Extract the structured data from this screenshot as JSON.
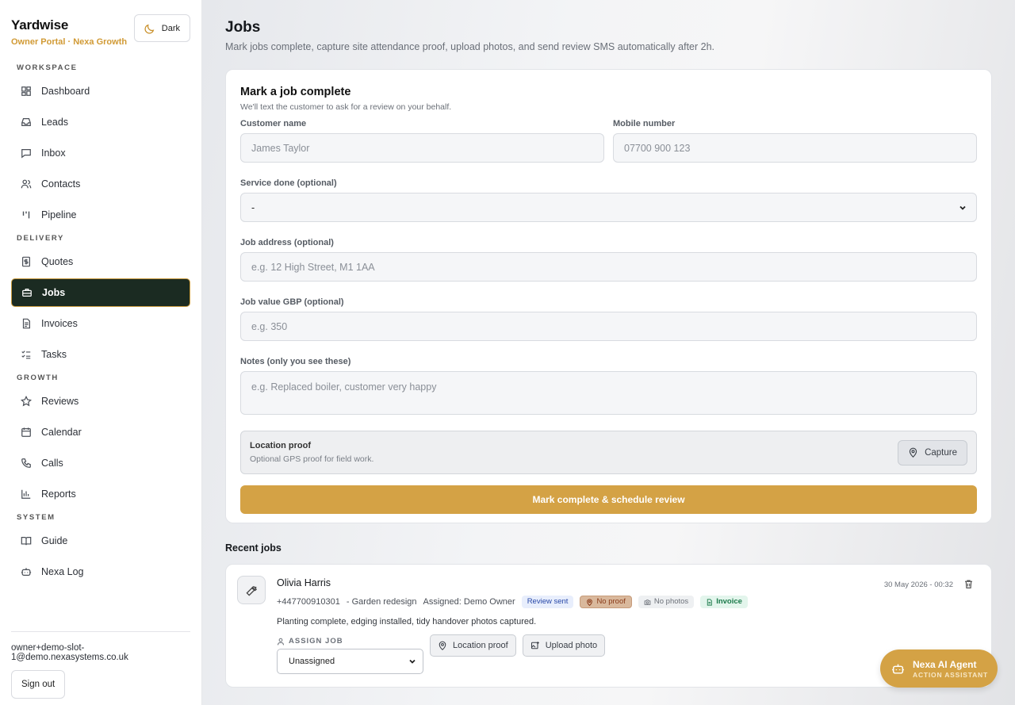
{
  "brand": {
    "name": "Yardwise",
    "subtitle": "Owner Portal · Nexa Growth",
    "theme_button": "Dark"
  },
  "sidebar": {
    "sections": [
      {
        "label": "WORKSPACE",
        "items": [
          {
            "label": "Dashboard",
            "icon": "dashboard-icon"
          },
          {
            "label": "Leads",
            "icon": "inbox-tray-icon"
          },
          {
            "label": "Inbox",
            "icon": "message-icon"
          },
          {
            "label": "Contacts",
            "icon": "users-icon"
          },
          {
            "label": "Pipeline",
            "icon": "pipeline-icon"
          }
        ]
      },
      {
        "label": "DELIVERY",
        "items": [
          {
            "label": "Quotes",
            "icon": "dollar-doc-icon"
          },
          {
            "label": "Jobs",
            "icon": "briefcase-icon",
            "active": true
          },
          {
            "label": "Invoices",
            "icon": "document-icon"
          },
          {
            "label": "Tasks",
            "icon": "checklist-icon"
          }
        ]
      },
      {
        "label": "GROWTH",
        "items": [
          {
            "label": "Reviews",
            "icon": "star-icon"
          },
          {
            "label": "Calendar",
            "icon": "calendar-icon"
          },
          {
            "label": "Calls",
            "icon": "phone-icon"
          },
          {
            "label": "Reports",
            "icon": "bar-chart-icon"
          }
        ]
      },
      {
        "label": "SYSTEM",
        "items": [
          {
            "label": "Guide",
            "icon": "book-icon"
          },
          {
            "label": "Nexa Log",
            "icon": "bot-icon"
          }
        ]
      }
    ],
    "email": "owner+demo-slot-1@demo.nexasystems.co.uk",
    "signout": "Sign out"
  },
  "page": {
    "title": "Jobs",
    "subtitle": "Mark jobs complete, capture site attendance proof, upload photos, and send review SMS automatically after 2h."
  },
  "form": {
    "title": "Mark a job complete",
    "subtitle": "We'll text the customer to ask for a review on your behalf.",
    "customer_label": "Customer name",
    "customer_placeholder": "James Taylor",
    "mobile_label": "Mobile number",
    "mobile_placeholder": "07700 900 123",
    "service_label": "Service done (optional)",
    "service_value": "-",
    "address_label": "Job address (optional)",
    "address_placeholder": "e.g. 12 High Street, M1 1AA",
    "value_label": "Job value GBP (optional)",
    "value_placeholder": "e.g. 350",
    "notes_label": "Notes (only you see these)",
    "notes_placeholder": "e.g. Replaced boiler, customer very happy",
    "proof_title": "Location proof",
    "proof_sub": "Optional GPS proof for field work.",
    "capture_label": "Capture",
    "submit_label": "Mark complete & schedule review"
  },
  "recent": {
    "title": "Recent jobs",
    "jobs": [
      {
        "name": "Olivia Harris",
        "phone": "+447700910301",
        "service": "- Garden redesign",
        "assigned": "Assigned: Demo Owner",
        "badges": {
          "review": "Review sent",
          "proof": "No proof",
          "photos": "No photos",
          "invoice": "Invoice"
        },
        "description": "Planting complete, edging installed, tidy handover photos captured.",
        "assign_label": "ASSIGN JOB",
        "assign_value": "Unassigned",
        "location_btn": "Location proof",
        "upload_btn": "Upload photo",
        "date": "30 May 2026 - 00:32"
      }
    ]
  },
  "agent": {
    "title": "Nexa AI Agent",
    "subtitle": "ACTION ASSISTANT"
  },
  "colors": {
    "accent": "#d4a245",
    "active_nav": "#1b2b22",
    "brand_sub": "#d19a35"
  }
}
